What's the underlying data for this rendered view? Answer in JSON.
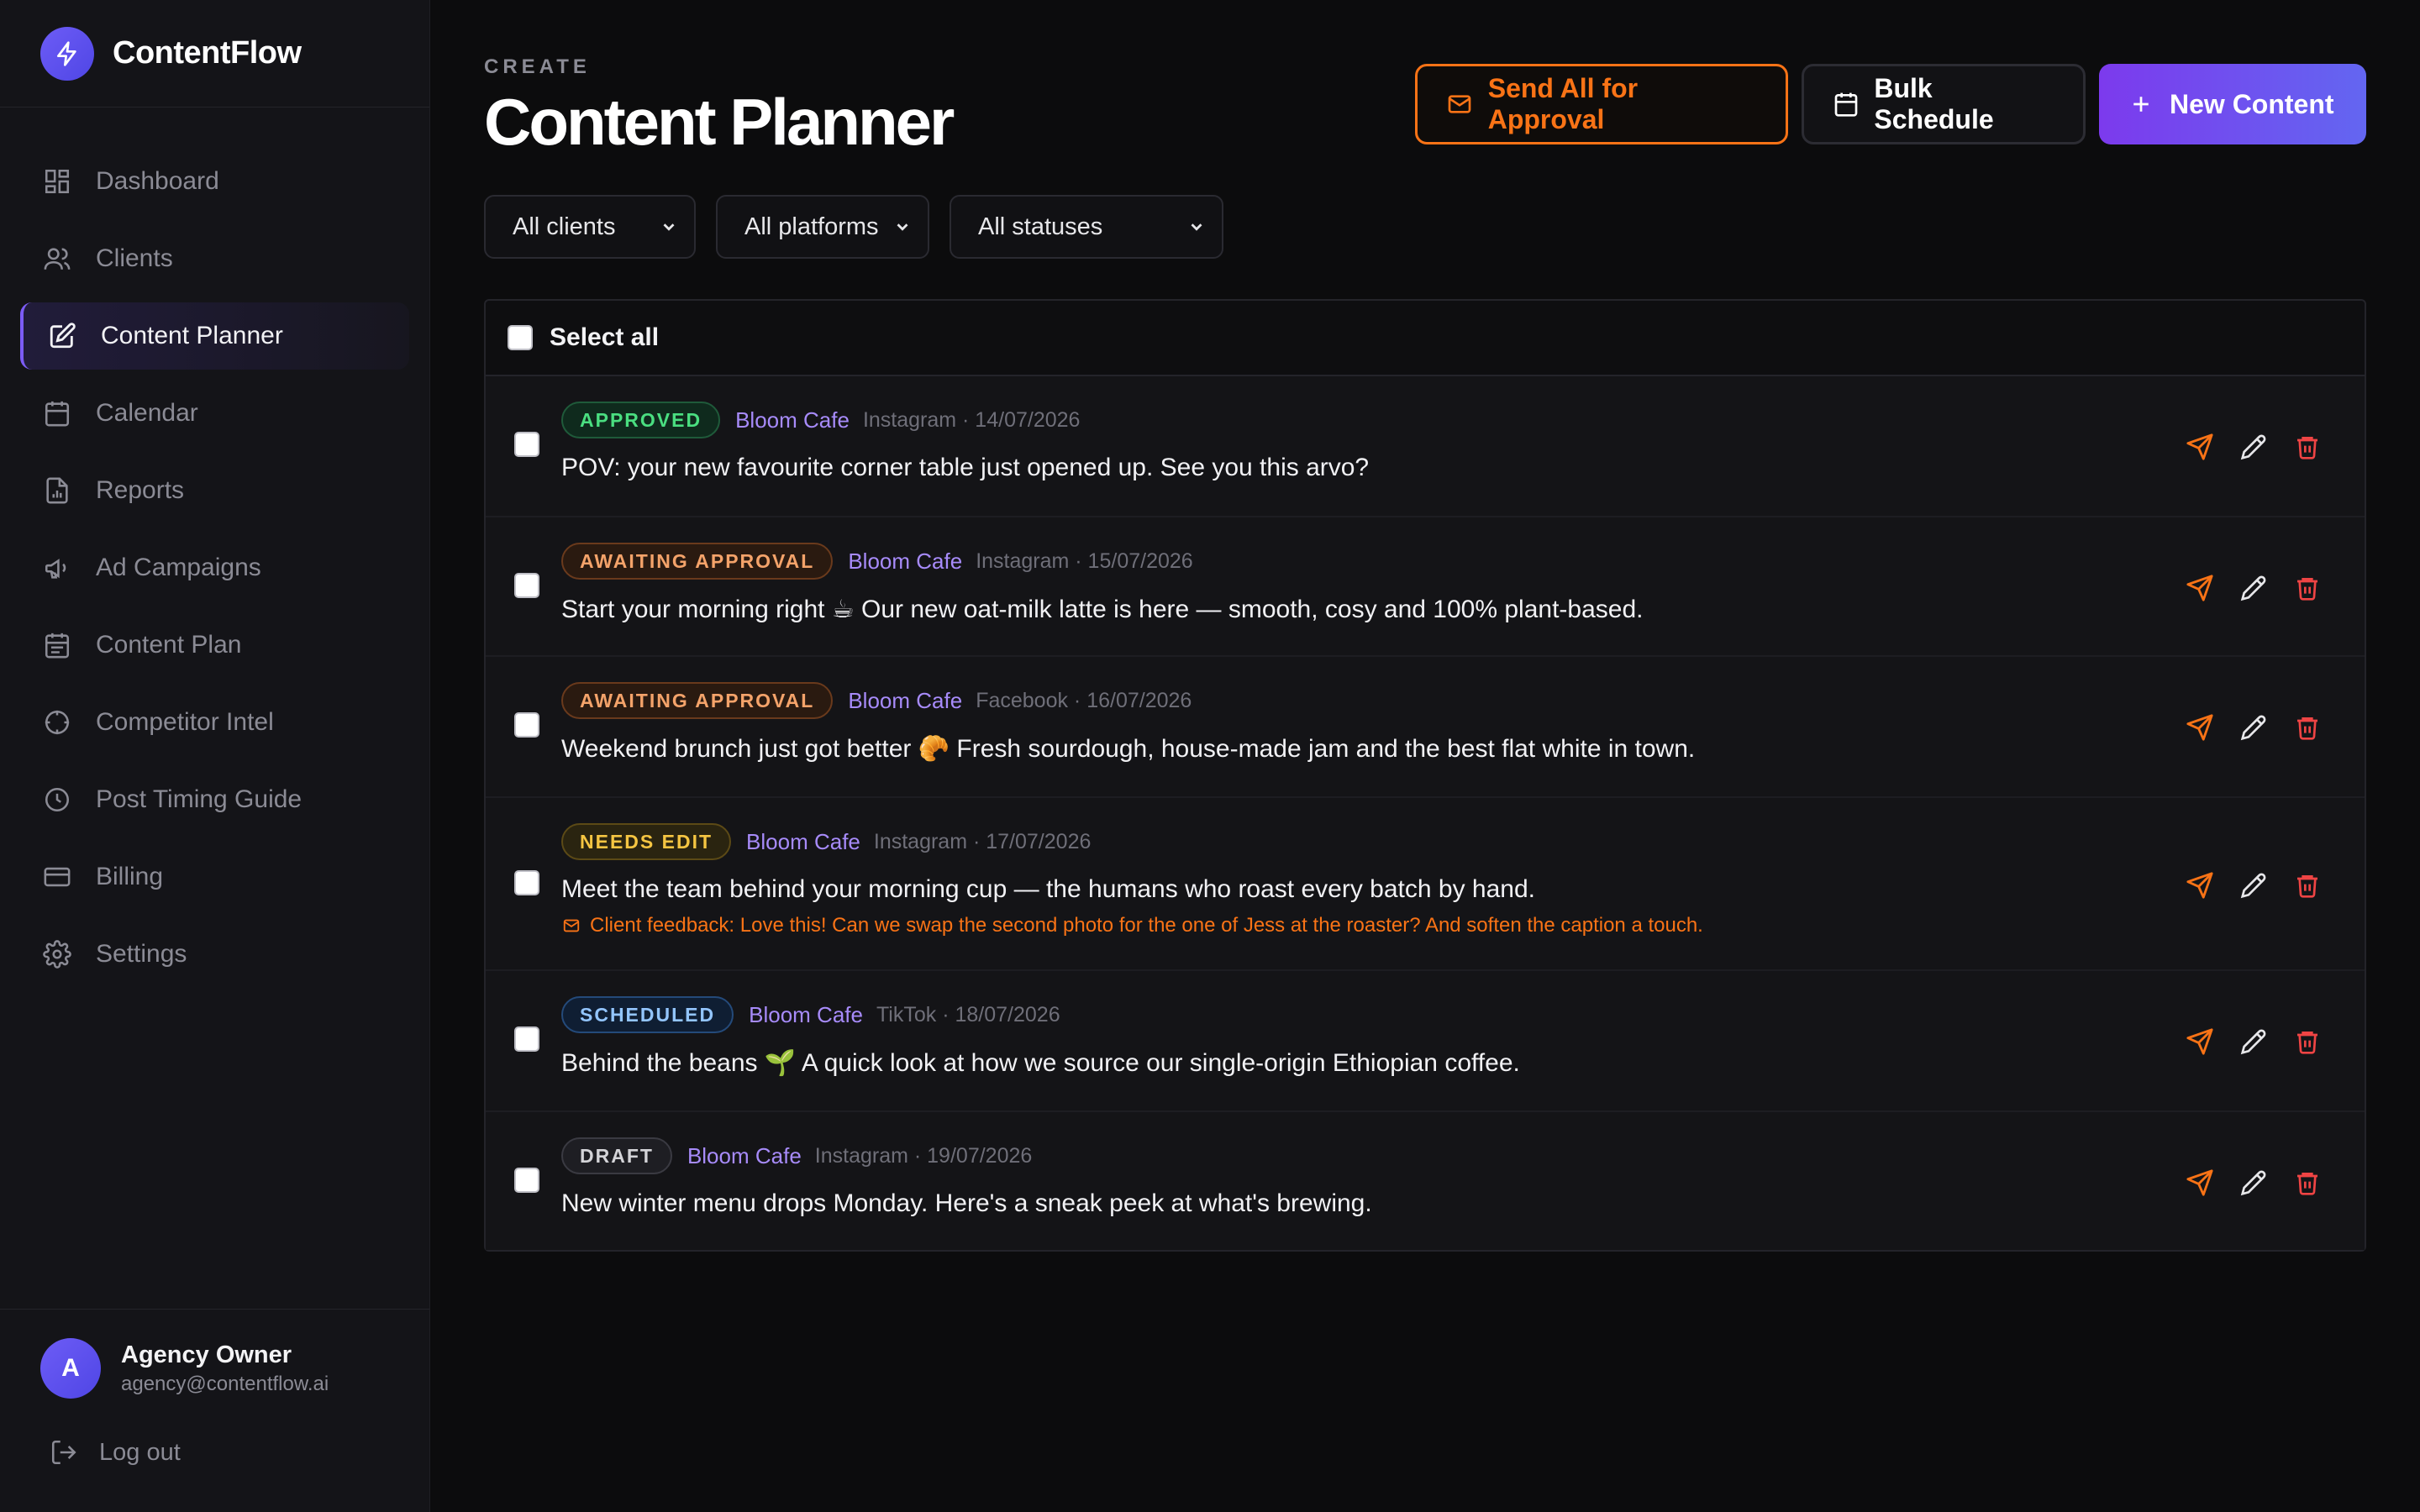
{
  "app": {
    "brand": "ContentFlow",
    "accent": "#7c5cf6",
    "orange": "#f97316"
  },
  "sidebar": {
    "items": [
      {
        "label": "Dashboard",
        "icon": "grid-icon"
      },
      {
        "label": "Clients",
        "icon": "users-icon"
      },
      {
        "label": "Content Planner",
        "icon": "edit-icon",
        "active": true
      },
      {
        "label": "Calendar",
        "icon": "calendar-icon"
      },
      {
        "label": "Reports",
        "icon": "report-icon"
      },
      {
        "label": "Ad Campaigns",
        "icon": "megaphone-icon"
      },
      {
        "label": "Content Plan",
        "icon": "calendar-icon"
      },
      {
        "label": "Competitor Intel",
        "icon": "crosshair-icon"
      },
      {
        "label": "Post Timing Guide",
        "icon": "clock-icon"
      },
      {
        "label": "Billing",
        "icon": "card-icon"
      },
      {
        "label": "Settings",
        "icon": "gear-icon"
      }
    ],
    "user": {
      "initial": "A",
      "name": "Agency Owner",
      "email": "agency@contentflow.ai"
    },
    "logout_label": "Log out"
  },
  "header": {
    "eyebrow": "CREATE",
    "title": "Content Planner",
    "send_all_label": "Send All for Approval",
    "bulk_schedule_label": "Bulk Schedule",
    "new_content_label": "New Content"
  },
  "filters": {
    "client": "All clients",
    "platform": "All platforms",
    "status": "All statuses"
  },
  "list": {
    "select_all_label": "Select all",
    "rows": [
      {
        "status": "APPROVED",
        "status_kind": "approved",
        "client": "Bloom Cafe",
        "meta": "Instagram · 14/07/2026",
        "text": "POV: your new favourite corner table just opened up. See you this arvo?",
        "feedback": ""
      },
      {
        "status": "AWAITING APPROVAL",
        "status_kind": "awaiting",
        "client": "Bloom Cafe",
        "meta": "Instagram · 15/07/2026",
        "text": "Start your morning right ☕ Our new oat-milk latte is here — smooth, cosy and 100% plant-based.",
        "feedback": ""
      },
      {
        "status": "AWAITING APPROVAL",
        "status_kind": "awaiting",
        "client": "Bloom Cafe",
        "meta": "Facebook · 16/07/2026",
        "text": "Weekend brunch just got better 🥐 Fresh sourdough, house-made jam and the best flat white in town.",
        "feedback": ""
      },
      {
        "status": "NEEDS EDIT",
        "status_kind": "needs",
        "client": "Bloom Cafe",
        "meta": "Instagram · 17/07/2026",
        "text": "Meet the team behind your morning cup — the humans who roast every batch by hand.",
        "feedback": "Client feedback: Love this! Can we swap the second photo for the one of Jess at the roaster? And soften the caption a touch."
      },
      {
        "status": "SCHEDULED",
        "status_kind": "scheduled",
        "client": "Bloom Cafe",
        "meta": "TikTok · 18/07/2026",
        "text": "Behind the beans 🌱 A quick look at how we source our single-origin Ethiopian coffee.",
        "feedback": ""
      },
      {
        "status": "DRAFT",
        "status_kind": "draft",
        "client": "Bloom Cafe",
        "meta": "Instagram · 19/07/2026",
        "text": "New winter menu drops Monday. Here's a sneak peek at what's brewing.",
        "feedback": ""
      }
    ]
  }
}
